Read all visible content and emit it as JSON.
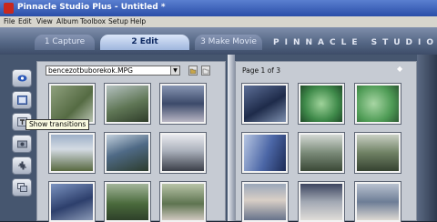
{
  "window": {
    "title": "Pinnacle Studio Plus - Untitled *"
  },
  "menu": [
    "File",
    "Edit",
    "View",
    "Album",
    "Toolbox",
    "Setup",
    "Help"
  ],
  "tabs": [
    {
      "label": "1 Capture",
      "active": false
    },
    {
      "label": "2 Edit",
      "active": true
    },
    {
      "label": "3 Make Movie",
      "active": false
    }
  ],
  "brand": "PINNACLE STUDIO",
  "album": {
    "file": "bencezotbuborekok.MPG",
    "page_label": "Page 1 of 3"
  },
  "tooltip": "Show transitions",
  "tools": [
    "video-icon",
    "transitions-icon",
    "titles-icon",
    "photos-icon",
    "audio-icon",
    "menus-icon"
  ],
  "colors": {
    "accent": "#2a4ea8",
    "panel": "#c6cbd3",
    "background": "#1c2634"
  }
}
